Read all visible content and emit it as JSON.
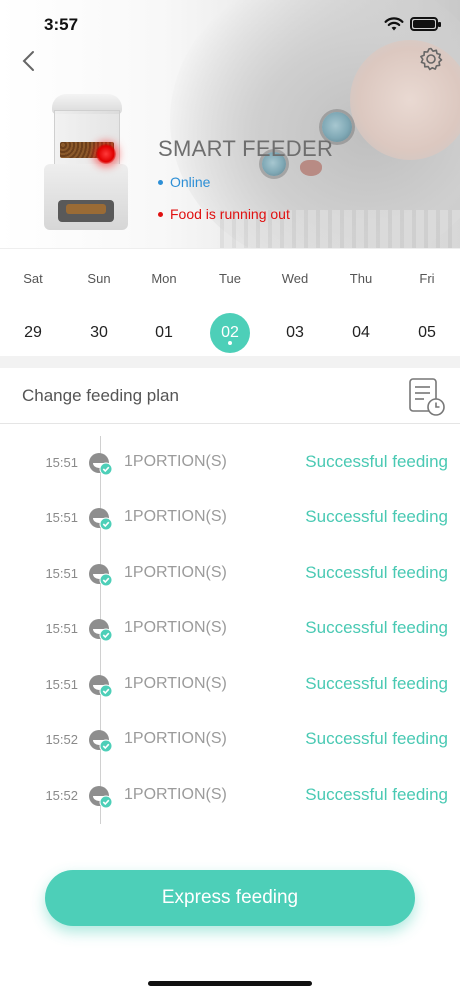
{
  "status_bar": {
    "time": "3:57"
  },
  "header": {
    "title": "SMART FEEDER",
    "online_text": "Online",
    "warning_text": "Food is running out",
    "online_color": "#2d8fd6",
    "warning_color": "#e01010"
  },
  "icons": {
    "back": "chevron-left-icon",
    "settings": "gear-icon",
    "plan": "schedule-list-icon",
    "feed": "bowl-check-icon"
  },
  "week": {
    "days": [
      {
        "name": "Sat",
        "date": "29"
      },
      {
        "name": "Sun",
        "date": "30"
      },
      {
        "name": "Mon",
        "date": "01"
      },
      {
        "name": "Tue",
        "date": "02",
        "selected": true
      },
      {
        "name": "Wed",
        "date": "03"
      },
      {
        "name": "Thu",
        "date": "04"
      },
      {
        "name": "Fri",
        "date": "05"
      }
    ]
  },
  "plan": {
    "label": "Change feeding plan"
  },
  "logs": [
    {
      "time": "15:51",
      "portion": "1PORTION(S)",
      "status": "Successful feeding"
    },
    {
      "time": "15:51",
      "portion": "1PORTION(S)",
      "status": "Successful feeding"
    },
    {
      "time": "15:51",
      "portion": "1PORTION(S)",
      "status": "Successful feeding"
    },
    {
      "time": "15:51",
      "portion": "1PORTION(S)",
      "status": "Successful feeding"
    },
    {
      "time": "15:51",
      "portion": "1PORTION(S)",
      "status": "Successful feeding"
    },
    {
      "time": "15:52",
      "portion": "1PORTION(S)",
      "status": "Successful feeding"
    },
    {
      "time": "15:52",
      "portion": "1PORTION(S)",
      "status": "Successful feeding"
    }
  ],
  "action": {
    "express_label": "Express feeding"
  },
  "colors": {
    "accent": "#4dcfb8",
    "success": "#49c9b3"
  }
}
